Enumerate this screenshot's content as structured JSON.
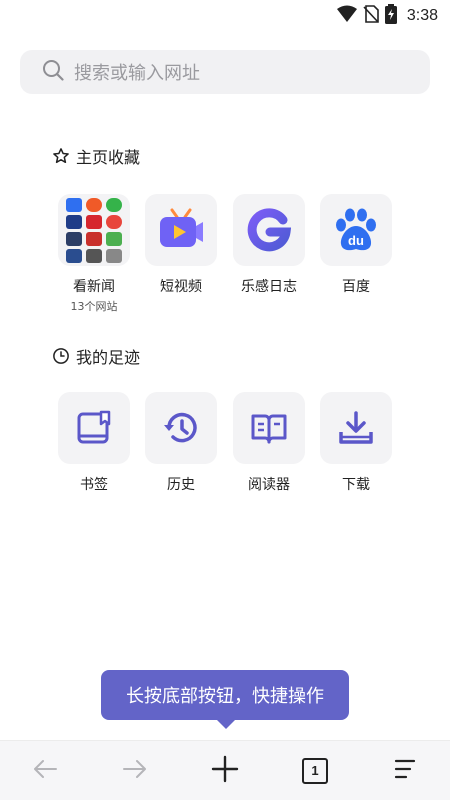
{
  "status": {
    "time": "3:38"
  },
  "search": {
    "placeholder": "搜索或输入网址"
  },
  "favorites": {
    "title": "主页收藏",
    "items": [
      {
        "label": "看新闻",
        "sub": "13个网站",
        "icon": "news-grid-icon"
      },
      {
        "label": "短视频",
        "icon": "tv-play-icon"
      },
      {
        "label": "乐感日志",
        "icon": "g-logo-icon"
      },
      {
        "label": "百度",
        "icon": "baidu-paw-icon"
      }
    ]
  },
  "footprints": {
    "title": "我的足迹",
    "items": [
      {
        "label": "书签",
        "icon": "bookmark-icon"
      },
      {
        "label": "历史",
        "icon": "history-icon"
      },
      {
        "label": "阅读器",
        "icon": "book-icon"
      },
      {
        "label": "下载",
        "icon": "download-icon"
      }
    ]
  },
  "tooltip": {
    "text": "长按底部按钮，快捷操作"
  },
  "toolbar": {
    "tab_count": "1"
  },
  "colors": {
    "accent": "#6364c8",
    "tile_bg": "#f3f3f5",
    "icon_purple": "#5b57c9",
    "baidu_blue": "#2f6ff0"
  }
}
